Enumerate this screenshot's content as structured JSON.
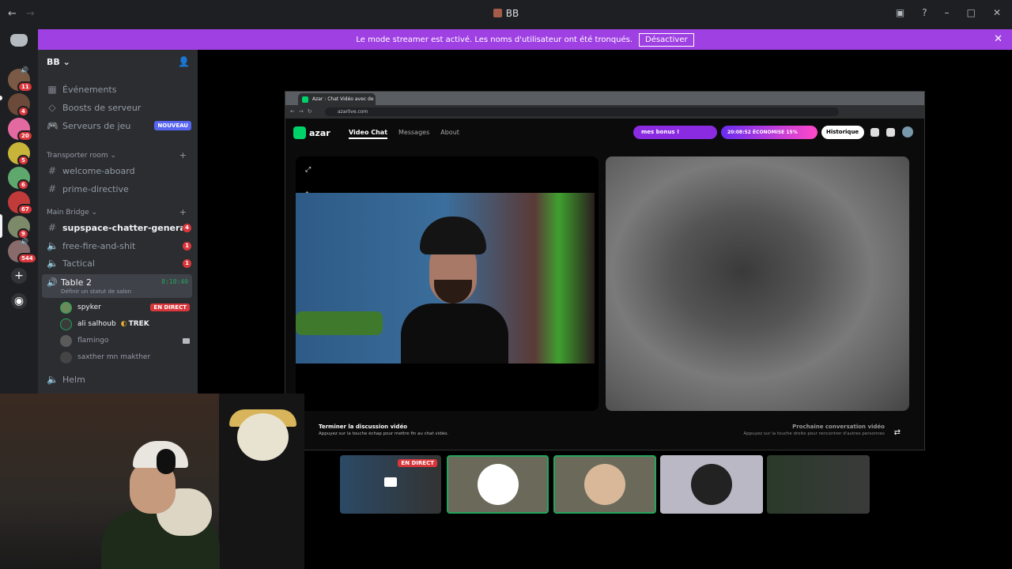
{
  "window": {
    "title": "BB"
  },
  "banner": {
    "text": "Le mode streamer est activé. Les noms d'utilisateur ont été tronqués.",
    "button": "Désactiver"
  },
  "servers": [
    {
      "badge": "11",
      "color": "#7a5a44",
      "speaker": true
    },
    {
      "badge": "4",
      "color": "#6b4a3a"
    },
    {
      "badge": "20",
      "color": "#e36aa0"
    },
    {
      "badge": "5",
      "color": "#c9b43a"
    },
    {
      "badge": "6",
      "color": "#5fa86d"
    },
    {
      "badge": "67",
      "color": "#c13b3b"
    },
    {
      "badge": "9",
      "color": "#7d8a6a"
    },
    {
      "badge": "544",
      "color": "#8a6b6b",
      "speaker": true
    }
  ],
  "sidebar": {
    "server_name": "BB",
    "top_items": [
      {
        "label": "Événements",
        "icon": "calendar-icon"
      },
      {
        "label": "Boosts de serveur",
        "icon": "boost-icon"
      },
      {
        "label": "Serveurs de jeu",
        "icon": "gamepad-icon",
        "badge": "NOUVEAU"
      }
    ],
    "category1": "Transporter room",
    "channels1": [
      "welcome-aboard",
      "prime-directive"
    ],
    "category2": "Main Bridge",
    "channels2": [
      {
        "label": "supspace-chatter-general",
        "badge": "4"
      },
      {
        "label": "free-fire-and-shit",
        "badge": "1"
      },
      {
        "label": "Tactical",
        "badge": "1"
      }
    ],
    "active_voice": {
      "name": "Table 2",
      "status": "Définir un statut de salon",
      "time": "8:10:40"
    },
    "voice_users": [
      {
        "name": "spyker",
        "tag": "EN DIRECT"
      },
      {
        "name": "ali salhoub",
        "tag": "TREK"
      },
      {
        "name": "flamingo"
      },
      {
        "name": "saxther mn makther"
      }
    ],
    "helm": "Helm"
  },
  "browser": {
    "tab_title": "Azar : Chat Vidéo avec de",
    "url": "azarlive.com",
    "nav": [
      "Video Chat",
      "Messages",
      "About"
    ],
    "logo": "azar",
    "bonus": "mes bonus !",
    "economy": "20:08:52  ÉCONOMISE 15%",
    "history": "Historique",
    "end_title": "Terminer la discussion vidéo",
    "end_sub": "Appuyez sur la touche échap pour mettre fin au chat vidéo.",
    "next_title": "Prochaine conversation vidéo",
    "next_sub": "Appuyez sur la touche droite pour rencontrer d'autres personnes"
  },
  "tiles": {
    "live_label": "EN DIRECT"
  }
}
